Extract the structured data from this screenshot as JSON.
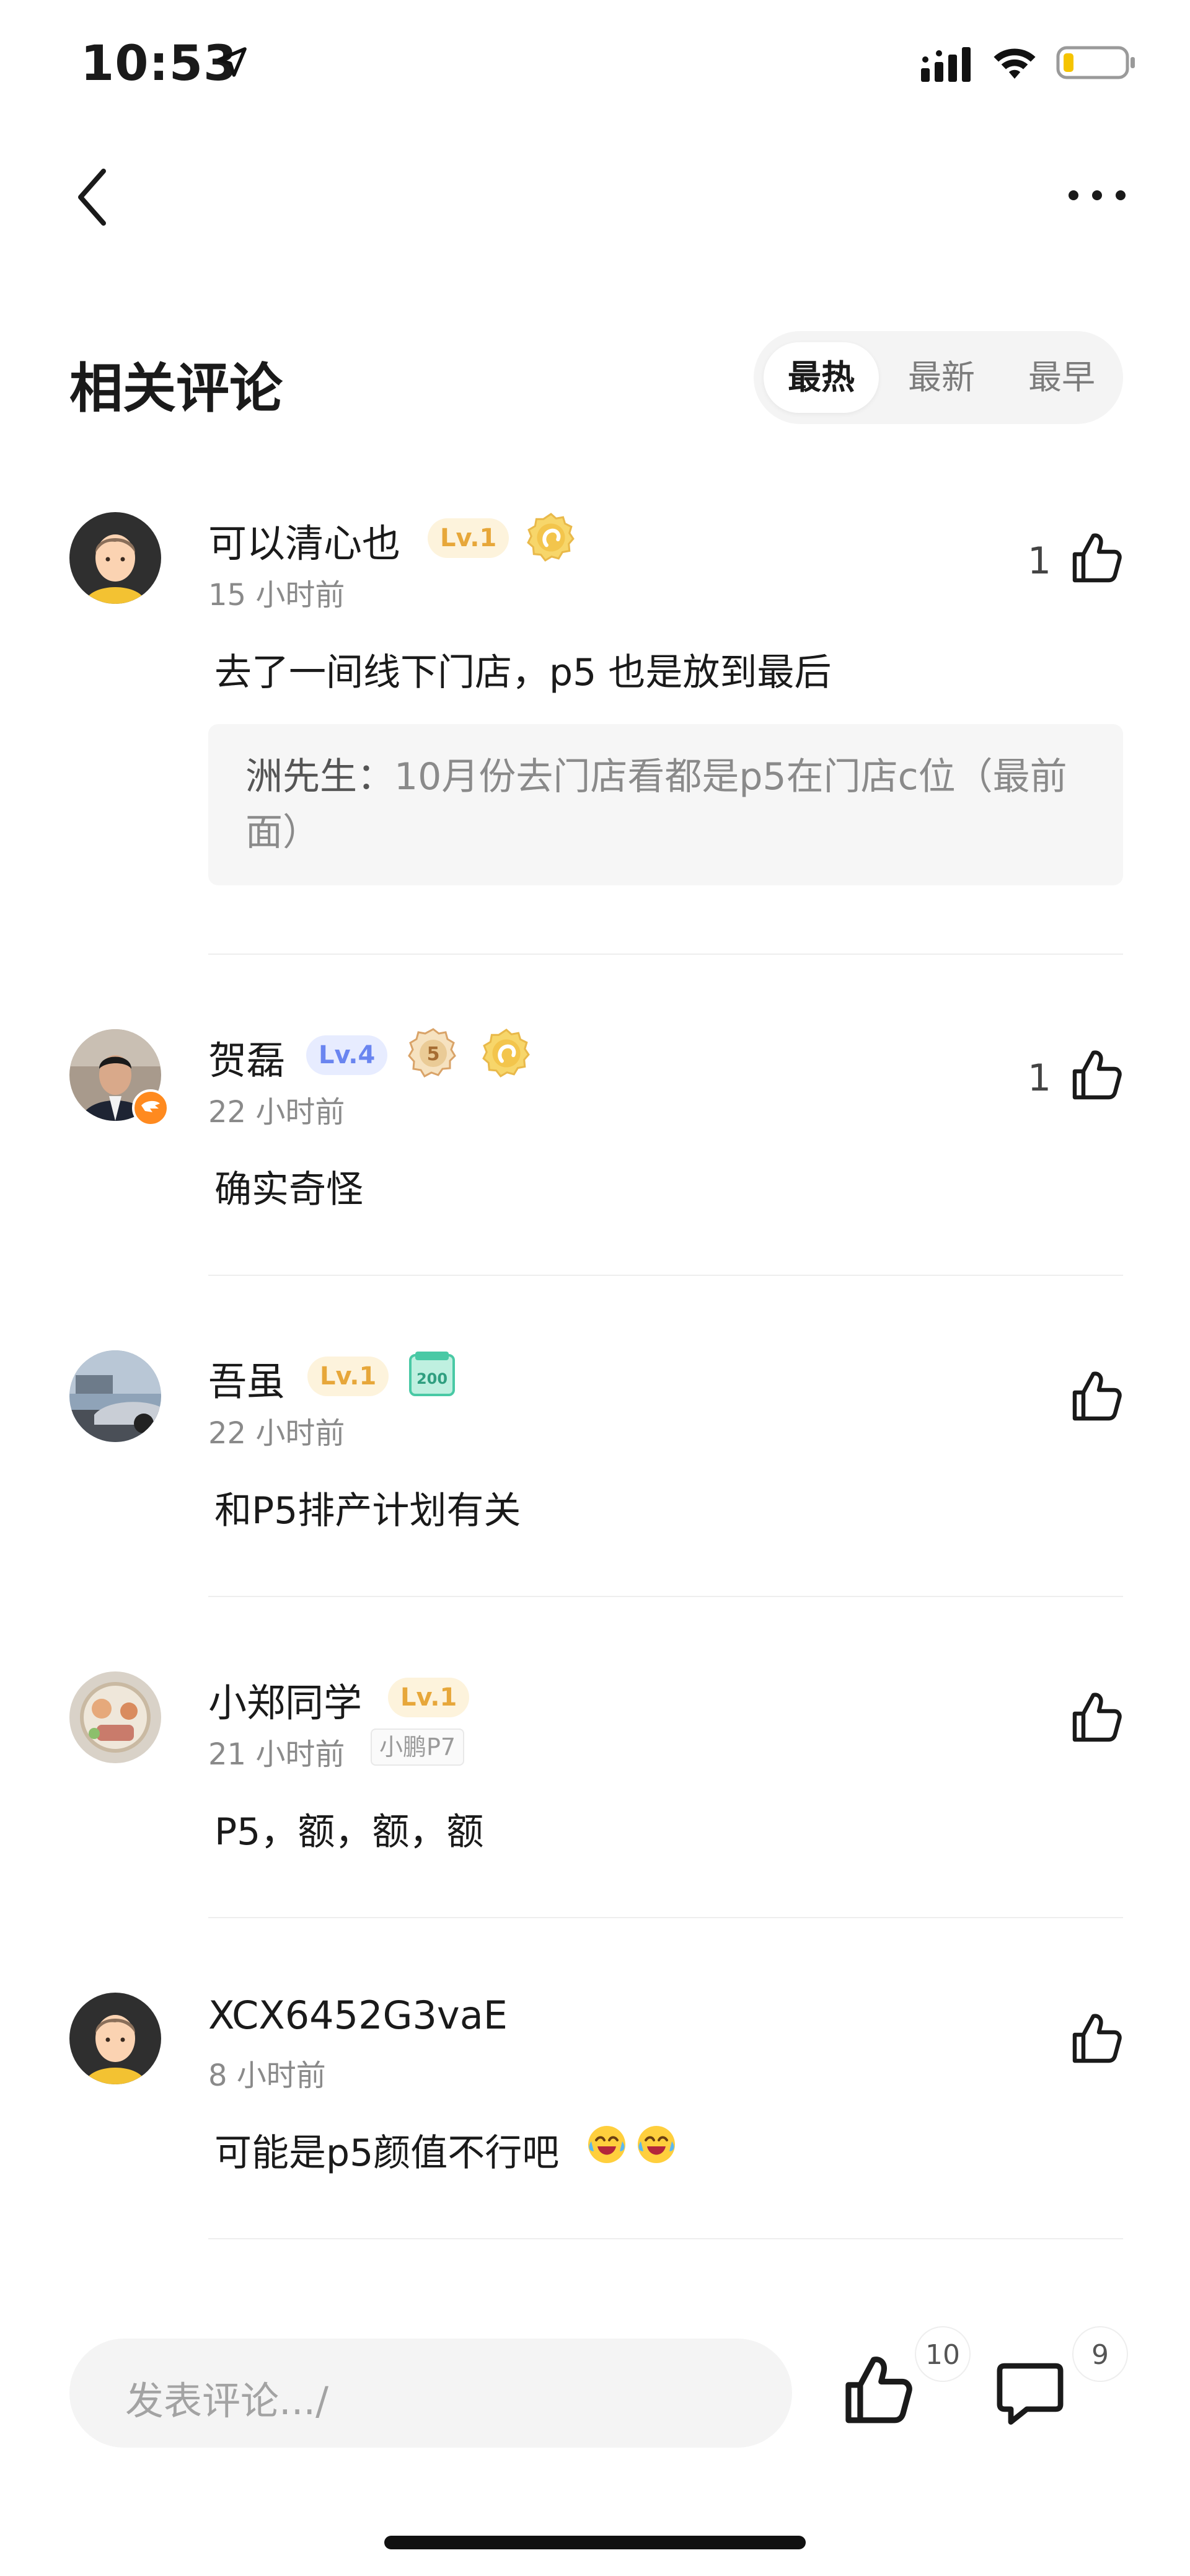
{
  "status_bar": {
    "time": "10:53"
  },
  "section": {
    "title": "相关评论",
    "sort_tabs": [
      {
        "label": "最热",
        "active": true
      },
      {
        "label": "最新",
        "active": false
      },
      {
        "label": "最早",
        "active": false
      }
    ]
  },
  "comments": [
    {
      "name": "可以清心也",
      "level": "Lv.1",
      "time": "15 小时前",
      "text": "去了一间线下门店，p5 也是放到最后",
      "likes": "1",
      "reply": {
        "author": "洲先生：",
        "text": "10月份去门店看都是p5在门店c位（最前面）"
      }
    },
    {
      "name": "贺磊",
      "level": "Lv.4",
      "time": "22 小时前",
      "text": "确实奇怪",
      "likes": "1"
    },
    {
      "name": "吾虽",
      "level": "Lv.1",
      "time": "22 小时前",
      "text": "和P5排产计划有关",
      "likes": ""
    },
    {
      "name": "小郑同学",
      "level": "Lv.1",
      "time": "21 小时前",
      "tag": "小鹏P7",
      "text": "P5，额，额，额",
      "likes": ""
    },
    {
      "name": "XCX6452G3vaE",
      "time": "8 小时前",
      "text": "可能是p5颜值不行吧",
      "likes": ""
    }
  ],
  "badges": {
    "medal_5": "5",
    "medal_200": "200"
  },
  "bottom_bar": {
    "input_placeholder": "发表评论.../",
    "like_count": "10",
    "comment_count": "9"
  },
  "colors": {
    "level_yellow": "#e7a73a",
    "level_blue": "#6a85f0",
    "gold_medal": "#f3c54c",
    "teal_badge": "#49c9a5"
  }
}
